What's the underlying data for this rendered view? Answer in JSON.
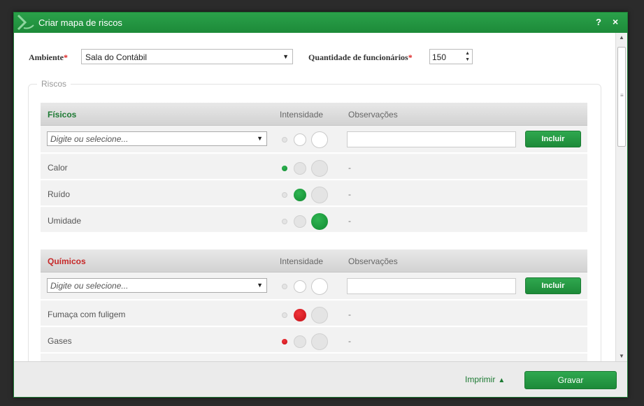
{
  "dialog": {
    "title": "Criar mapa de riscos",
    "help": "?",
    "close": "×"
  },
  "form": {
    "ambiente_label": "Ambiente",
    "required_mark": "*",
    "ambiente_value": "Sala do Contábil",
    "qty_label": "Quantidade de funcionários",
    "qty_value": "150"
  },
  "riscos": {
    "legend": "Riscos",
    "col_intensidade": "Intensidade",
    "col_observacoes": "Observações",
    "select_placeholder": "Digite ou selecione...",
    "include_label": "Incluir",
    "groups": [
      {
        "title": "Físicos",
        "color": "#1d7a33",
        "items": [
          {
            "name": "Calor",
            "intensity": 1,
            "obs": "-"
          },
          {
            "name": "Ruído",
            "intensity": 2,
            "obs": "-"
          },
          {
            "name": "Umidade",
            "intensity": 3,
            "obs": "-"
          }
        ]
      },
      {
        "title": "Químicos",
        "color": "#c62828",
        "items": [
          {
            "name": "Fumaça com fuligem",
            "intensity": 2,
            "obs": "-"
          },
          {
            "name": "Gases",
            "intensity": 1,
            "obs": "-"
          }
        ]
      }
    ]
  },
  "footer": {
    "print_label": "Imprimir",
    "save_label": "Gravar"
  }
}
